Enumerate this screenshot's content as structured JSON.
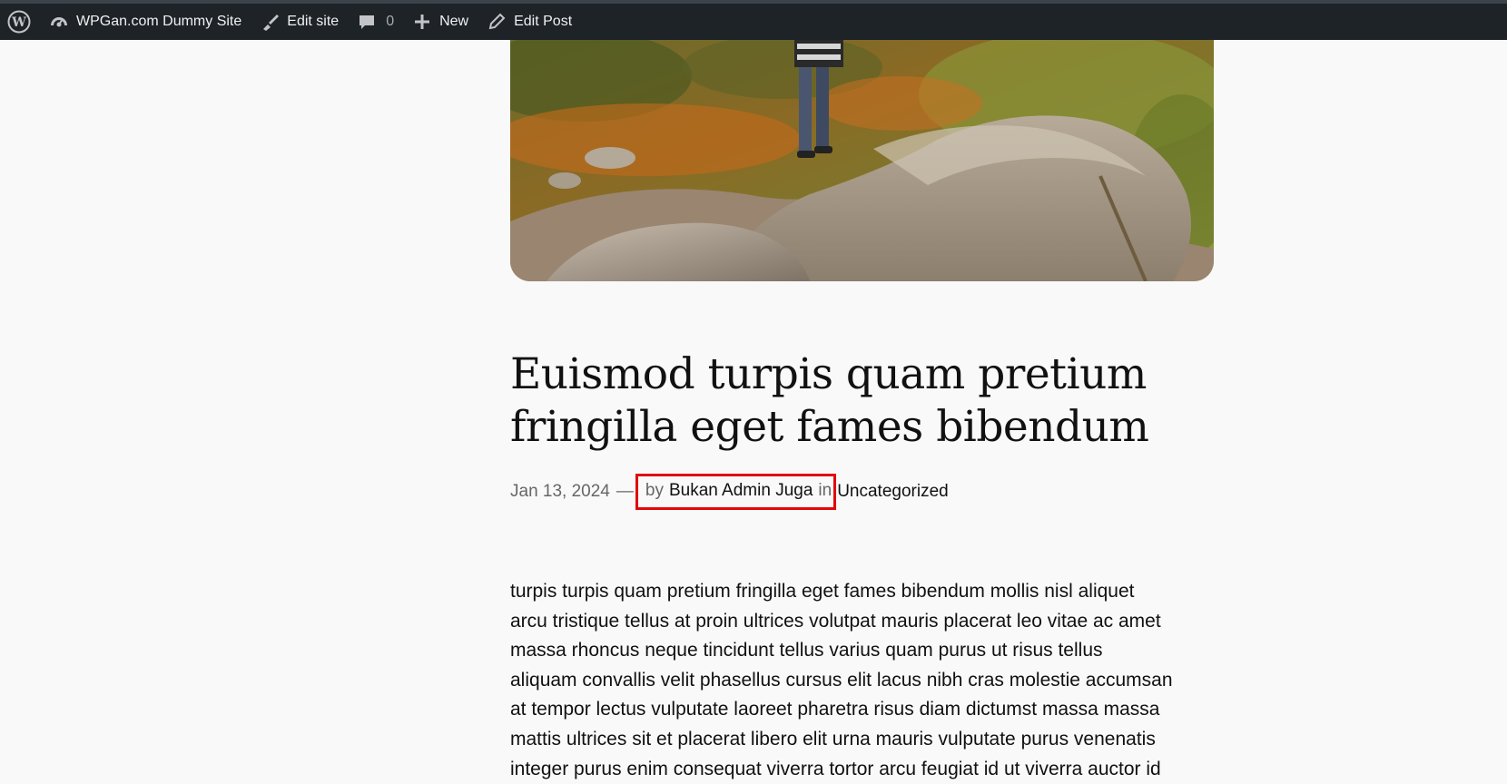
{
  "admin_bar": {
    "site_name": "WPGan.com Dummy Site",
    "edit_site": "Edit site",
    "comments_count": "0",
    "new_label": "New",
    "edit_post": "Edit Post"
  },
  "post": {
    "title_line1": "Euismod turpis quam pretium",
    "title_line2": "fringilla eget fames bibendum",
    "date": "Jan 13, 2024",
    "dash": "—",
    "by": "by",
    "author": "Bukan Admin Juga",
    "in": "in",
    "category": "Uncategorized",
    "body_lines": [
      "turpis turpis quam pretium fringilla eget fames bibendum mollis nisl aliquet",
      "arcu tristique tellus at proin ultrices volutpat mauris placerat leo vitae ac amet",
      "massa rhoncus neque tincidunt tellus varius quam purus ut risus tellus",
      "aliquam convallis velit phasellus cursus elit lacus nibh cras molestie accumsan",
      "at tempor lectus vulputate laoreet pharetra risus diam dictumst massa massa",
      "mattis ultrices sit et placerat libero elit urna mauris vulputate purus venenatis",
      "integer purus enim consequat viverra tortor arcu feugiat id ut viverra auctor id"
    ]
  },
  "colors": {
    "admin_bar_bg": "#1d2327",
    "highlight_border": "#e00a0a",
    "page_bg": "#f9f9f9"
  }
}
